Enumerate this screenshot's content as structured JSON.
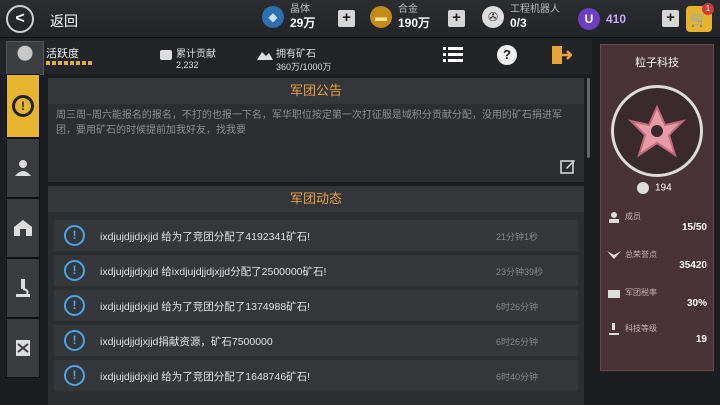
{
  "topbar": {
    "back_label": "返回",
    "crystal": {
      "label": "晶体",
      "value": "29万"
    },
    "alloy": {
      "label": "合金",
      "value": "190万"
    },
    "robot": {
      "label": "工程机器人",
      "value": "0/3"
    },
    "u_value": "410",
    "cart_badge": "1"
  },
  "header": {
    "activity_label": "活跃度",
    "contribution": {
      "label": "累计贡献",
      "value": "2,232"
    },
    "ore": {
      "label": "拥有矿石",
      "value": "360万/1000万"
    }
  },
  "notice": {
    "title": "军团公告",
    "text": "周三周~周六能报名的报名，不打的也报一下名，军华职位按定第一次打征服是域积分贡献分配，没用的矿石捐进军团，要用矿石的时候提前加我好友，找我要"
  },
  "activity": {
    "title": "军团动态",
    "rows": [
      {
        "text": "ixdjujdjjdjxjjd 给为了竞团分配了4192341矿石!",
        "time": "21分钟1秒"
      },
      {
        "text": "ixdjujdjjdjxjjd 给ixdjujdjjdjxjjd分配了2500000矿石!",
        "time": "23分钟39秒"
      },
      {
        "text": "ixdjujdjjdjxjjd 给为了竞团分配了1374988矿石!",
        "time": "6时26分钟"
      },
      {
        "text": "ixdjujdjjdjxjjd捐献资源，矿石7500000",
        "time": "6时26分钟"
      },
      {
        "text": "ixdjujdjjdjxjjd 给为了竞团分配了1648746矿石!",
        "time": "6时40分钟"
      }
    ]
  },
  "side": {
    "name": "粒子科技",
    "level": "194",
    "members_label": "成员",
    "members_value": "15/50",
    "honor_label": "总荣誉点",
    "honor_value": "35420",
    "tax_label": "军团税率",
    "tax_value": "30%",
    "tech_label": "科技等级",
    "tech_value": "19"
  }
}
